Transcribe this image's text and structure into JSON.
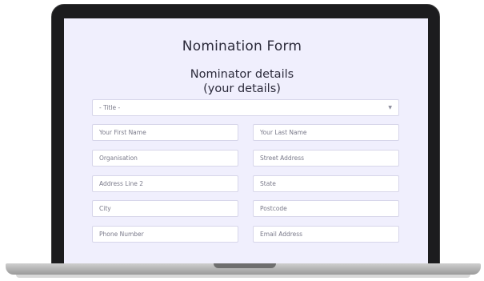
{
  "form": {
    "title": "Nomination Form",
    "section_line1": "Nominator details",
    "section_line2": "(your details)",
    "title_select": "- Title -",
    "fields": {
      "first_name": "Your First Name",
      "last_name": "Your Last Name",
      "organisation": "Organisation",
      "street_address": "Street Address",
      "address_line2": "Address Line 2",
      "state": "State",
      "city": "City",
      "postcode": "Postcode",
      "phone": "Phone Number",
      "email": "Email Address"
    }
  },
  "icons": {
    "select_chevron": "chevron-down-icon"
  },
  "colors": {
    "screen_background": "#f0effd",
    "field_border": "#d7d6ea",
    "bezel": "#1c1c1e"
  }
}
